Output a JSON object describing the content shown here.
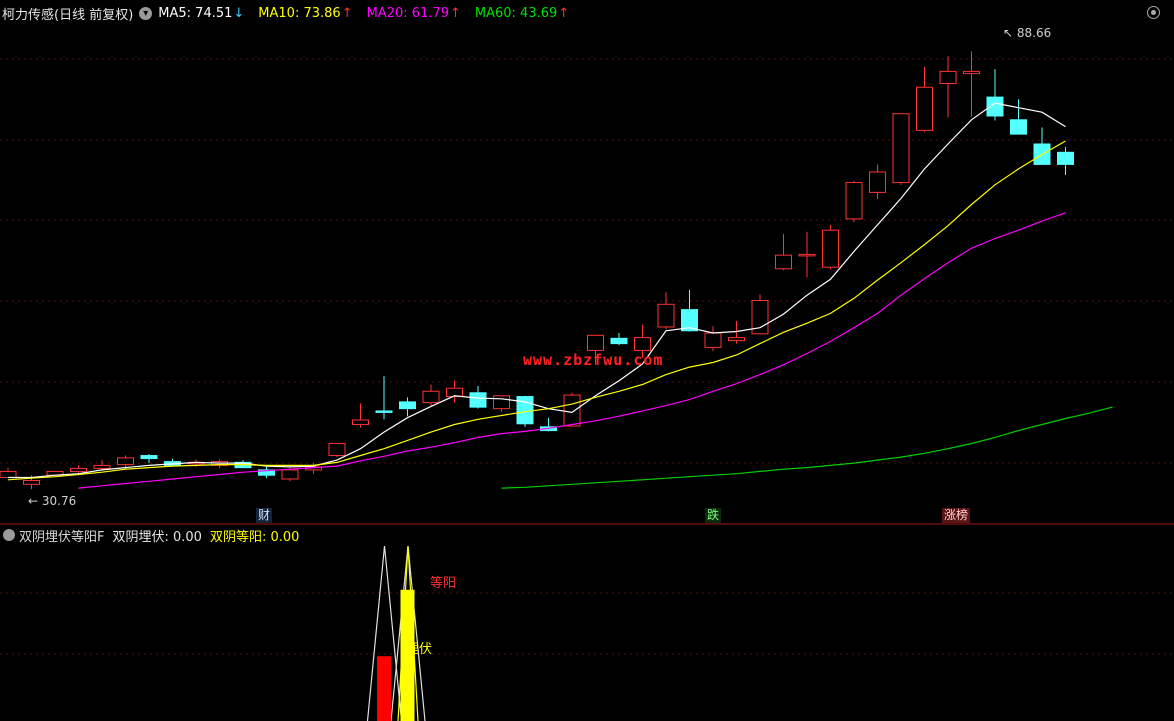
{
  "header": {
    "title": "柯力传感(日线 前复权)",
    "ma": [
      {
        "label": "MA5: 74.51",
        "arrow": "↓",
        "dir": "down",
        "color": "#ffffff"
      },
      {
        "label": "MA10: 73.86",
        "arrow": "↑",
        "dir": "up",
        "color": "#ffff00"
      },
      {
        "label": "MA20: 61.79",
        "arrow": "↑",
        "dir": "up",
        "color": "#ff00ff"
      },
      {
        "label": "MA60: 43.69",
        "arrow": "↑",
        "dir": "up",
        "color": "#00e000"
      }
    ]
  },
  "watermark": "www.zbzfwu.com",
  "annotations": {
    "high": "88.66",
    "low": "30.76"
  },
  "events": {
    "cai": "财",
    "die": "跌",
    "zhangbang": "涨榜"
  },
  "indicator": {
    "name": "双阴埋伏等阳F",
    "v1": "双阴埋伏: 0.00",
    "v2": "双阴等阳: 0.00",
    "label_maifu": "埋伏",
    "label_dengyang": "等阳"
  },
  "chart_data": [
    {
      "type": "candlestick",
      "title": "柯力传感(日线 前复权)",
      "ylim": [
        28,
        92
      ],
      "up_color": "#ff3333",
      "down_color": "#54ffff",
      "candles": [
        [
          32.3,
          33.6,
          32.7,
          33.1
        ],
        [
          31.4,
          32.6,
          30.76,
          31.9
        ],
        [
          32.6,
          33.1,
          32.6,
          33.1
        ],
        [
          33.1,
          33.9,
          32.6,
          33.5
        ],
        [
          33.5,
          34.6,
          33.2,
          33.9
        ],
        [
          34.0,
          35.2,
          33.5,
          34.9
        ],
        [
          35.2,
          35.4,
          34.2,
          34.8
        ],
        [
          34.4,
          34.8,
          33.9,
          33.9
        ],
        [
          34.3,
          34.7,
          33.7,
          34.3
        ],
        [
          33.9,
          34.7,
          33.5,
          34.4
        ],
        [
          34.3,
          34.6,
          33.7,
          33.6
        ],
        [
          33.3,
          33.7,
          32.2,
          32.6
        ],
        [
          32.1,
          33.8,
          31.8,
          33.3
        ],
        [
          33.3,
          34.2,
          32.8,
          33.7
        ],
        [
          35.2,
          36.6,
          35.0,
          36.8
        ],
        [
          39.3,
          42.1,
          38.9,
          39.9
        ],
        [
          41.1,
          45.7,
          40.0,
          41.0
        ],
        [
          42.3,
          42.9,
          40.4,
          41.4
        ],
        [
          42.2,
          44.6,
          41.8,
          43.7
        ],
        [
          43.0,
          45.1,
          42.2,
          44.1
        ],
        [
          43.5,
          44.4,
          41.4,
          41.6
        ],
        [
          41.4,
          43.1,
          41.0,
          43.1
        ],
        [
          43.0,
          43.1,
          39.0,
          39.4
        ],
        [
          39.0,
          40.2,
          38.4,
          38.5
        ],
        [
          39.1,
          43.5,
          39.0,
          43.2
        ],
        [
          49.1,
          51.1,
          47.2,
          51.1
        ],
        [
          50.7,
          51.4,
          49.8,
          50.0
        ],
        [
          49.1,
          52.5,
          48.1,
          50.8
        ],
        [
          52.2,
          56.8,
          51.9,
          55.2
        ],
        [
          54.5,
          57.1,
          51.6,
          51.7
        ],
        [
          49.5,
          52.3,
          49.0,
          51.4
        ],
        [
          50.4,
          53.0,
          50.0,
          50.8
        ],
        [
          51.3,
          56.5,
          51.2,
          55.7
        ],
        [
          59.9,
          64.5,
          59.7,
          61.7
        ],
        [
          61.8,
          64.8,
          58.8,
          61.8
        ],
        [
          60.1,
          65.7,
          59.8,
          65.0
        ],
        [
          66.5,
          71.5,
          66.1,
          71.3
        ],
        [
          70.0,
          73.7,
          69.1,
          72.7
        ],
        [
          71.3,
          80.3,
          71.0,
          80.4
        ],
        [
          78.2,
          86.6,
          78.0,
          83.9
        ],
        [
          84.4,
          88.0,
          79.9,
          86.0
        ],
        [
          85.7,
          88.66,
          80.0,
          86.0
        ],
        [
          82.6,
          86.3,
          79.5,
          80.1
        ],
        [
          79.6,
          82.3,
          78.6,
          77.7
        ],
        [
          76.4,
          78.6,
          73.9,
          73.7
        ],
        [
          75.3,
          76.0,
          72.3,
          73.7
        ]
      ],
      "ma_series": [
        {
          "name": "MA5",
          "color": "#ffffff",
          "start": 0,
          "values": [
            32.3,
            32.3,
            32.6,
            32.8,
            33.3,
            33.6,
            33.9,
            34.1,
            34.3,
            34.2,
            34.2,
            33.8,
            33.7,
            33.8,
            34.6,
            36.1,
            38.3,
            40.2,
            41.7,
            43.1,
            42.8,
            42.7,
            42.3,
            41.4,
            40.9,
            43.1,
            45.1,
            47.3,
            51.7,
            52.1,
            51.4,
            51.6,
            52.1,
            53.9,
            56.4,
            58.5,
            62.2,
            65.7,
            69.2,
            73.1,
            76.4,
            79.6,
            81.8,
            81.2,
            80.6,
            78.7
          ]
        },
        {
          "name": "MA10",
          "color": "#ffff00",
          "start": 0,
          "values": [
            32.0,
            32.2,
            32.4,
            32.7,
            33.0,
            33.4,
            33.6,
            33.8,
            33.9,
            34.0,
            34.0,
            33.9,
            33.9,
            33.9,
            34.3,
            35.2,
            36.1,
            37.2,
            38.3,
            39.3,
            40.0,
            40.5,
            41.0,
            41.4,
            42.0,
            42.9,
            43.7,
            44.6,
            45.9,
            46.9,
            47.5,
            48.5,
            50.0,
            51.5,
            52.7,
            54.0,
            56.0,
            58.4,
            60.7,
            63.1,
            65.6,
            68.4,
            71.0,
            73.1,
            75.0,
            76.8
          ]
        },
        {
          "name": "MA20",
          "color": "#ff00ff",
          "start": 3,
          "values": [
            30.9,
            31.2,
            31.5,
            31.8,
            32.1,
            32.4,
            32.7,
            33.0,
            33.2,
            33.4,
            33.6,
            33.8,
            34.5,
            35.1,
            35.8,
            36.3,
            36.9,
            37.6,
            38.1,
            38.4,
            38.8,
            39.3,
            39.8,
            40.4,
            41.1,
            41.8,
            42.6,
            43.7,
            44.7,
            45.9,
            47.2,
            48.7,
            50.3,
            52.1,
            54.0,
            56.4,
            58.6,
            60.7,
            62.6,
            63.9,
            65.0,
            66.2,
            67.3
          ]
        },
        {
          "name": "MA60",
          "color": "#00d000",
          "start": 21,
          "values": [
            30.9,
            31.0,
            31.2,
            31.4,
            31.6,
            31.8,
            32.0,
            32.2,
            32.4,
            32.6,
            32.8,
            33.1,
            33.4,
            33.6,
            33.9,
            34.2,
            34.6,
            35.0,
            35.5,
            36.1,
            36.8,
            37.6,
            38.5,
            39.3,
            40.1,
            40.8,
            41.6
          ]
        }
      ]
    },
    {
      "type": "indicator",
      "title": "双阴埋伏等阳F",
      "series": [
        {
          "name": "双阴埋伏",
          "color": "#ff0000",
          "x": 16,
          "value": 0.37
        },
        {
          "name": "双阴等阳",
          "color": "#ffff00",
          "x": 17,
          "value": 0.75
        }
      ]
    }
  ]
}
